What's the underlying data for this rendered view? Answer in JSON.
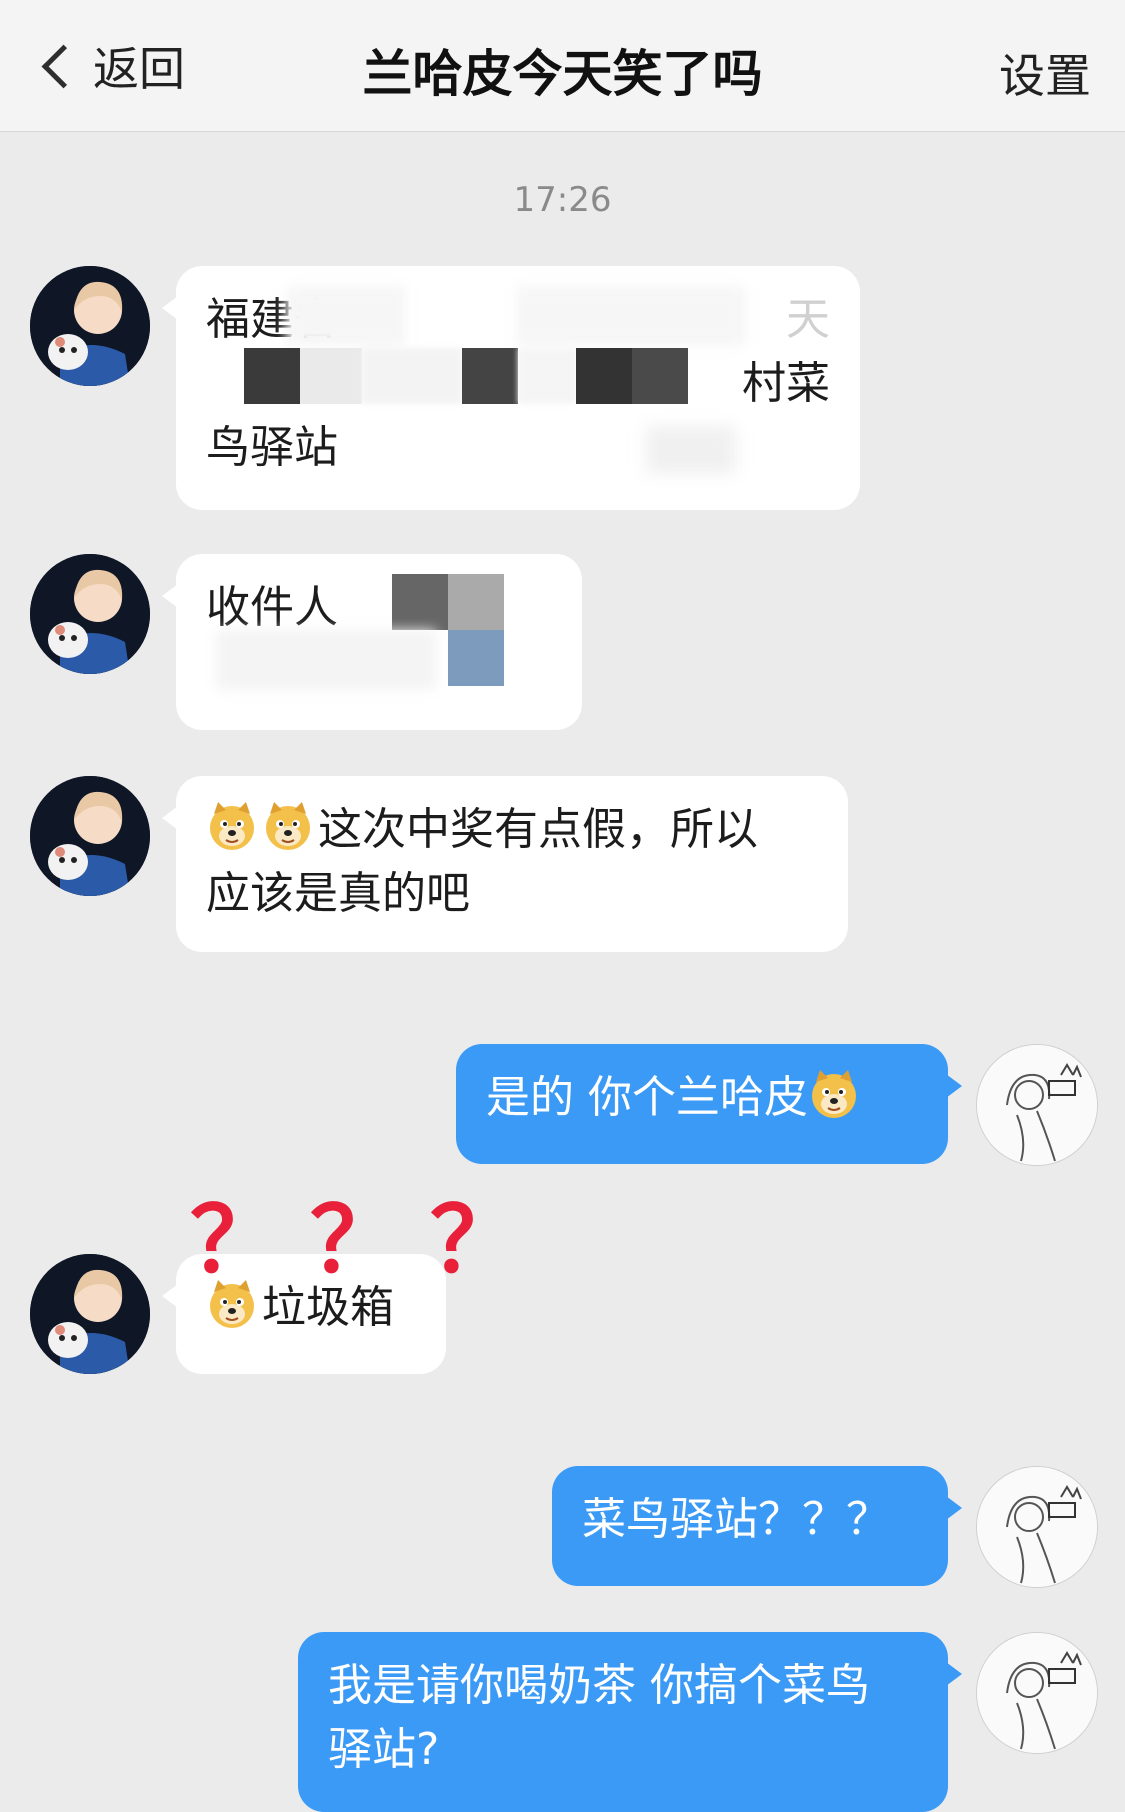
{
  "nav": {
    "back_label": "返回",
    "title": "兰哈皮今天笑了吗",
    "settings_label": "设置"
  },
  "timestamp": "17:26",
  "messages": [
    {
      "sender": "other",
      "line1": "福建省",
      "line1_end": "天",
      "line2_end": "村菜",
      "line3": "鸟驿站"
    },
    {
      "sender": "other",
      "text": "收件人"
    },
    {
      "sender": "other",
      "line1": "这次中奖有点假，所以",
      "line2": "应该是真的吧"
    },
    {
      "sender": "me",
      "text": "是的  你个兰哈皮"
    },
    {
      "sender": "other",
      "text": "垃圾箱",
      "overlay": "？？？"
    },
    {
      "sender": "me",
      "text": "菜鸟驿站？？？"
    },
    {
      "sender": "me",
      "line1": "我是请你喝奶茶 你搞个菜鸟",
      "line2": "驿站?"
    }
  ],
  "colors": {
    "out_bubble": "#3b9af5",
    "in_bubble": "#ffffff",
    "background": "#ebebeb",
    "qmark": "#e8203a"
  }
}
